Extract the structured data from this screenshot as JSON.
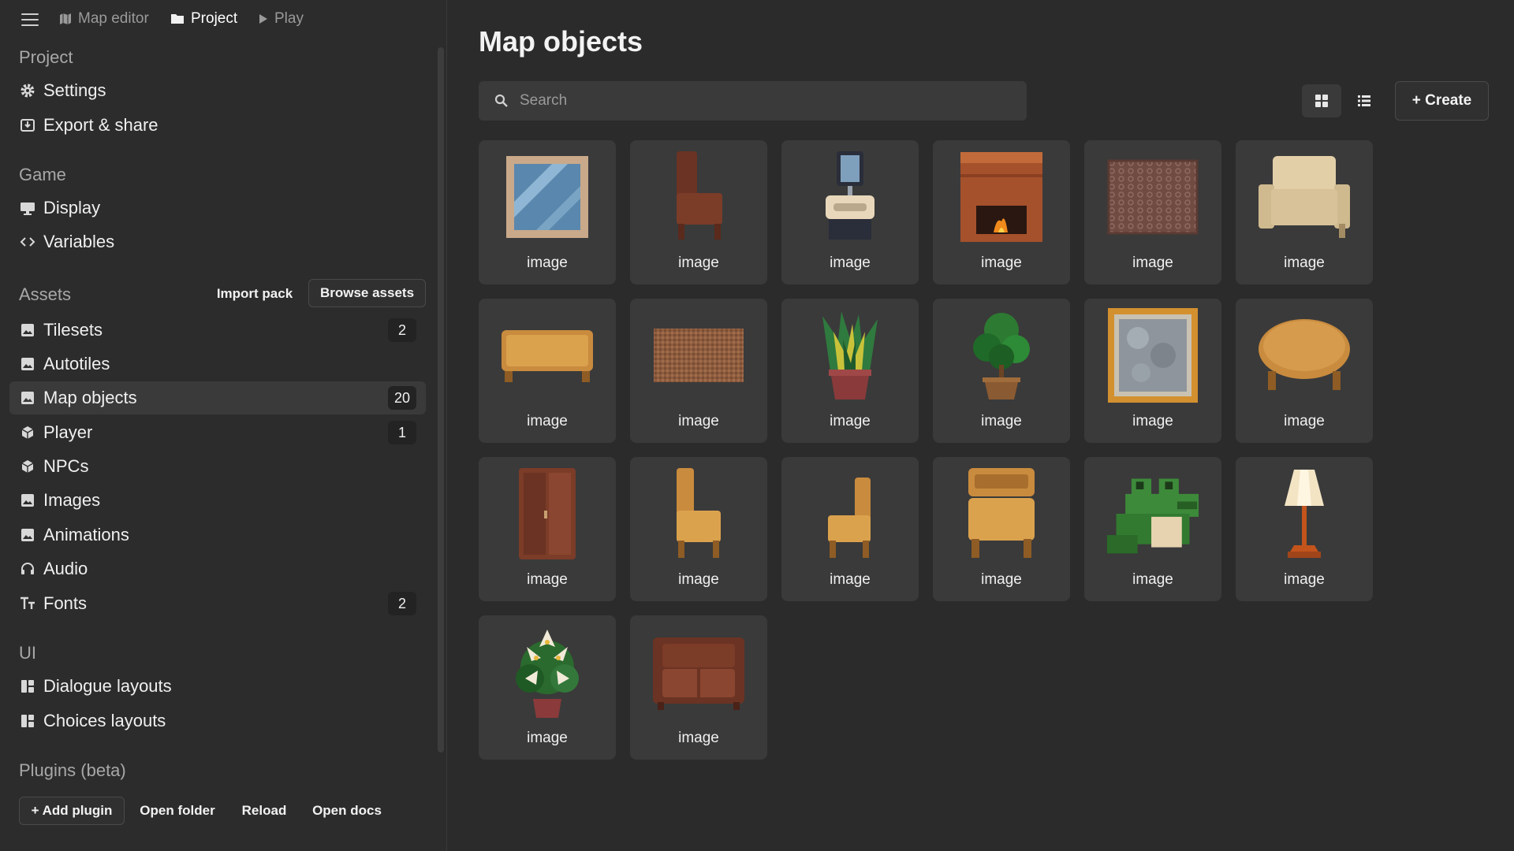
{
  "breadcrumb": {
    "map_editor": "Map editor",
    "project": "Project",
    "play": "Play"
  },
  "sidebar": {
    "project": {
      "title": "Project",
      "items": [
        {
          "label": "Settings",
          "icon": "gear-icon"
        },
        {
          "label": "Export & share",
          "icon": "export-icon"
        }
      ]
    },
    "game": {
      "title": "Game",
      "items": [
        {
          "label": "Display",
          "icon": "monitor-icon"
        },
        {
          "label": "Variables",
          "icon": "code-icon"
        }
      ]
    },
    "assets": {
      "title": "Assets",
      "import_pack": "Import pack",
      "browse_assets": "Browse assets",
      "items": [
        {
          "label": "Tilesets",
          "icon": "image-icon",
          "count": "2"
        },
        {
          "label": "Autotiles",
          "icon": "image-icon",
          "count": ""
        },
        {
          "label": "Map objects",
          "icon": "image-icon",
          "count": "20",
          "selected": true
        },
        {
          "label": "Player",
          "icon": "cube-icon",
          "count": "1"
        },
        {
          "label": "NPCs",
          "icon": "cube-icon",
          "count": ""
        },
        {
          "label": "Images",
          "icon": "image-icon",
          "count": ""
        },
        {
          "label": "Animations",
          "icon": "image-icon",
          "count": ""
        },
        {
          "label": "Audio",
          "icon": "headphones-icon",
          "count": ""
        },
        {
          "label": "Fonts",
          "icon": "font-icon",
          "count": "2"
        }
      ]
    },
    "ui": {
      "title": "UI",
      "items": [
        {
          "label": "Dialogue layouts",
          "icon": "layout-icon"
        },
        {
          "label": "Choices layouts",
          "icon": "layout-icon"
        }
      ]
    },
    "plugins": {
      "title": "Plugins (beta)",
      "add_plugin": "+ Add plugin",
      "open_folder": "Open folder",
      "reload": "Reload",
      "open_docs": "Open docs"
    }
  },
  "main": {
    "title": "Map objects",
    "search_placeholder": "Search",
    "create_label": "+ Create",
    "objects": [
      {
        "caption": "image",
        "sprite": "window"
      },
      {
        "caption": "image",
        "sprite": "dark-chair"
      },
      {
        "caption": "image",
        "sprite": "sink-mirror"
      },
      {
        "caption": "image",
        "sprite": "fireplace"
      },
      {
        "caption": "image",
        "sprite": "rug-pattern"
      },
      {
        "caption": "image",
        "sprite": "beige-armchair"
      },
      {
        "caption": "image",
        "sprite": "bench"
      },
      {
        "caption": "image",
        "sprite": "doormat"
      },
      {
        "caption": "image",
        "sprite": "snake-plant"
      },
      {
        "caption": "image",
        "sprite": "potted-tree"
      },
      {
        "caption": "image",
        "sprite": "stone-window"
      },
      {
        "caption": "image",
        "sprite": "round-table"
      },
      {
        "caption": "image",
        "sprite": "wardrobe"
      },
      {
        "caption": "image",
        "sprite": "chair-left"
      },
      {
        "caption": "image",
        "sprite": "chair-right"
      },
      {
        "caption": "image",
        "sprite": "chair-front"
      },
      {
        "caption": "image",
        "sprite": "frog"
      },
      {
        "caption": "image",
        "sprite": "floor-lamp"
      },
      {
        "caption": "image",
        "sprite": "lily-plant"
      },
      {
        "caption": "image",
        "sprite": "sofa"
      }
    ]
  },
  "colors": {
    "background": "#2b2b2b",
    "sidebar": "#2c2c2c",
    "card": "#3a3a3a",
    "text": "#ececec",
    "muted": "#a8a8a8"
  }
}
